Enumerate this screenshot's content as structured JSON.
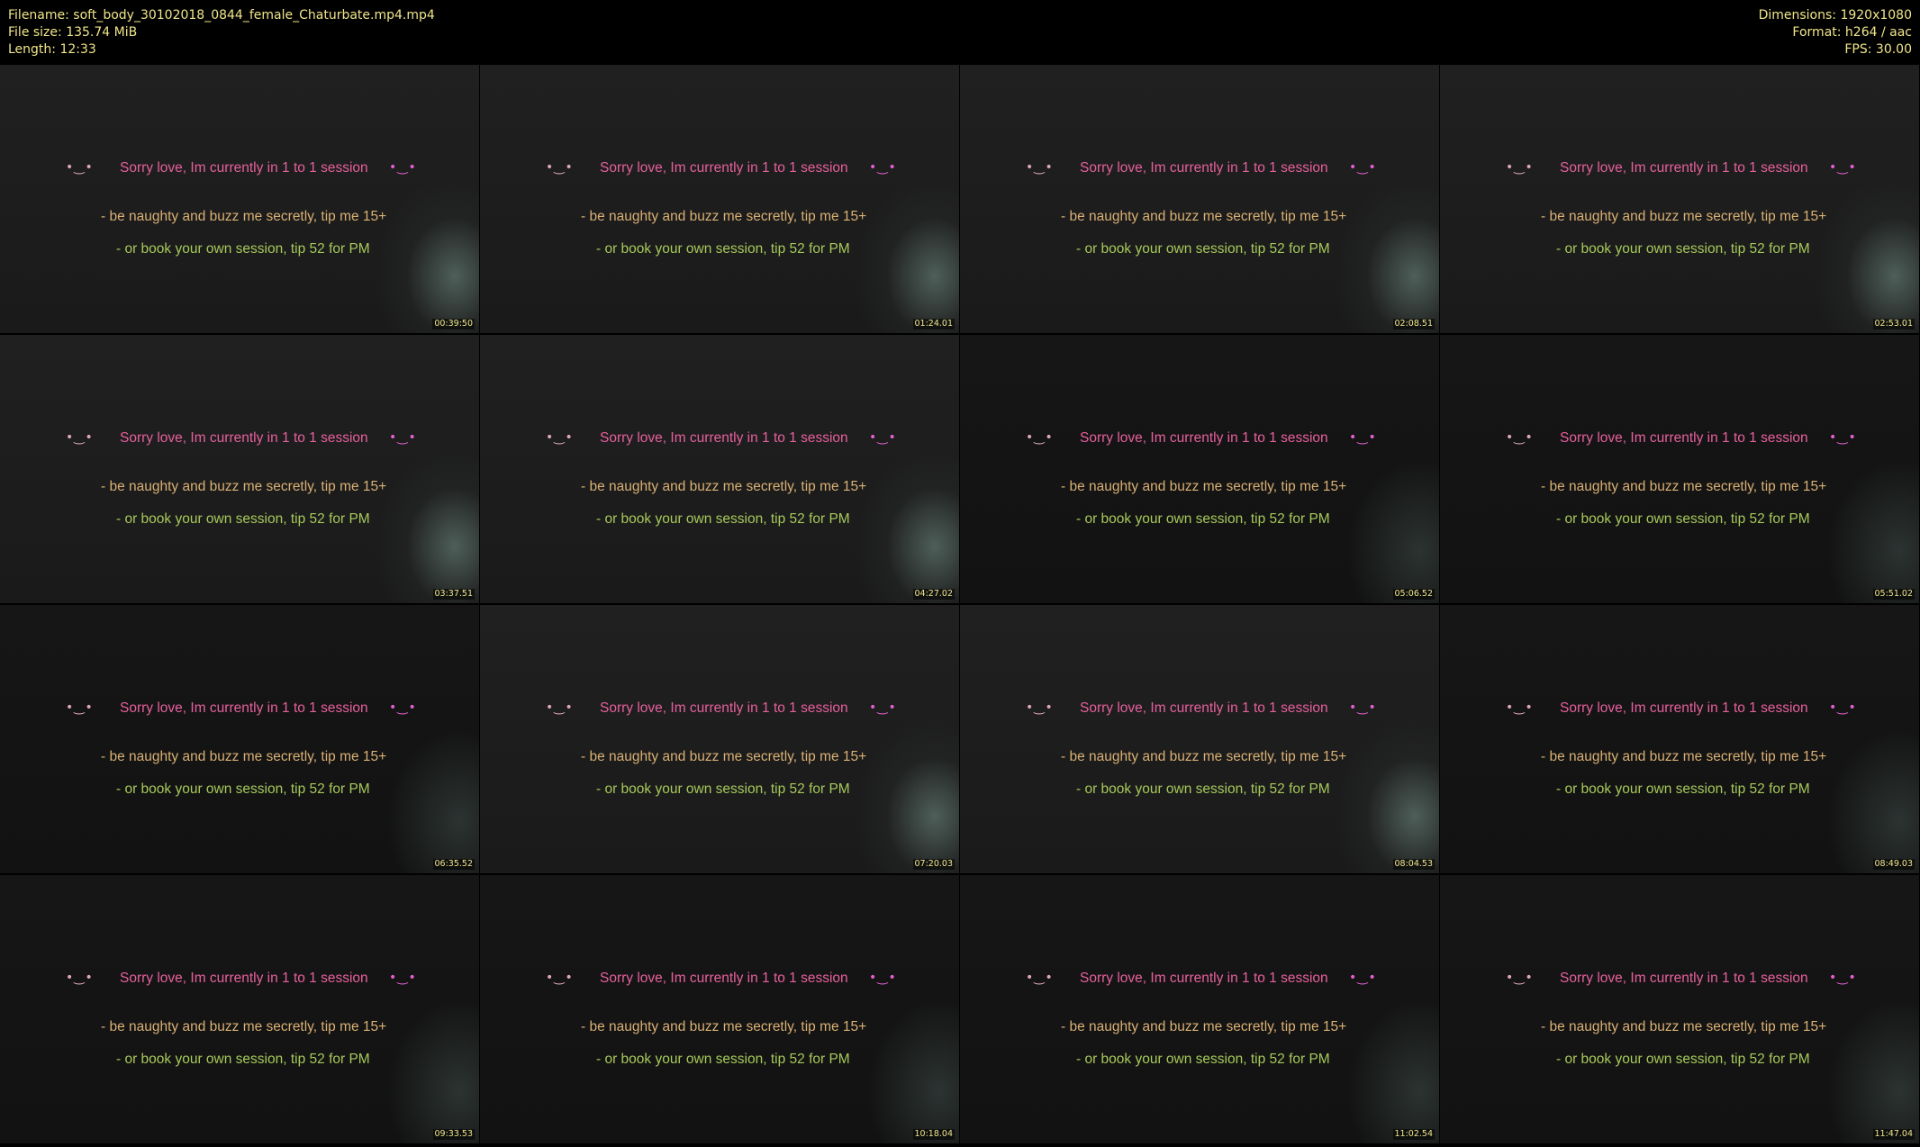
{
  "header": {
    "filename": "Filename: soft_body_30102018_0844_female_Chaturbate.mp4.mp4",
    "filesize": "File size: 135.74 MiB",
    "length": "Length: 12:33",
    "dimensions": "Dimensions: 1920x1080",
    "format": "Format: h264 / aac",
    "fps": "FPS: 30.00"
  },
  "overlay": {
    "face_left": "•‿•",
    "face_right": "•‿•",
    "line1": "Sorry love, Im currently in 1 to 1 session",
    "line2": "- be naughty and buzz me secretly, tip me 15+",
    "line3": "- or book your own session, tip 52 for PM"
  },
  "thumbnails": [
    {
      "timestamp": "00:39:50"
    },
    {
      "timestamp": "01:24.01"
    },
    {
      "timestamp": "02:08.51"
    },
    {
      "timestamp": "02:53.01"
    },
    {
      "timestamp": "03:37.51"
    },
    {
      "timestamp": "04:27.02"
    },
    {
      "timestamp": "05:06.52"
    },
    {
      "timestamp": "05:51.02"
    },
    {
      "timestamp": "06:35.52"
    },
    {
      "timestamp": "07:20.03"
    },
    {
      "timestamp": "08:04.53"
    },
    {
      "timestamp": "08:49.03"
    },
    {
      "timestamp": "09:33.53"
    },
    {
      "timestamp": "10:18.04"
    },
    {
      "timestamp": "11:02.54"
    },
    {
      "timestamp": "11:47.04"
    }
  ],
  "colors": {
    "header_text": "#f0e58a",
    "line1": "#e6609c",
    "line2": "#d9b074",
    "line3": "#a6c95a"
  }
}
